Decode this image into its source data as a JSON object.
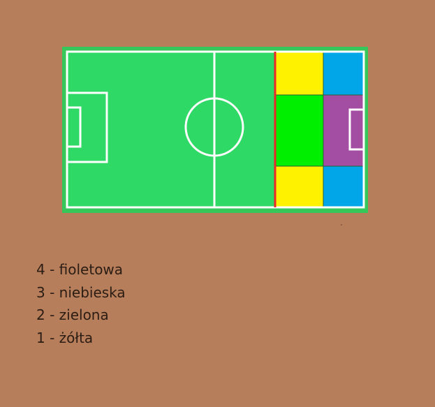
{
  "colors": {
    "background": "#b77e5b",
    "pitch_border": "#35c75a",
    "pitch_grass": "#2ed966",
    "pitch_lines": "#ffffff",
    "divider_line": "#e8282b",
    "zone_yellow": "#fff200",
    "zone_green": "#00ef00",
    "zone_blue": "#00a6e8",
    "zone_purple": "#a44ea3",
    "legend_text": "#2b1d14"
  },
  "legend": [
    {
      "number": "4",
      "label": "4 - fioletowa",
      "color_name": "fioletowa",
      "zone_color": "#a44ea3"
    },
    {
      "number": "3",
      "label": "3 - niebieska",
      "color_name": "niebieska",
      "zone_color": "#00a6e8"
    },
    {
      "number": "2",
      "label": "2 - zielona",
      "color_name": "zielona",
      "zone_color": "#00ef00"
    },
    {
      "number": "1",
      "label": "1 - żółta",
      "color_name": "żółta",
      "zone_color": "#fff200"
    }
  ]
}
